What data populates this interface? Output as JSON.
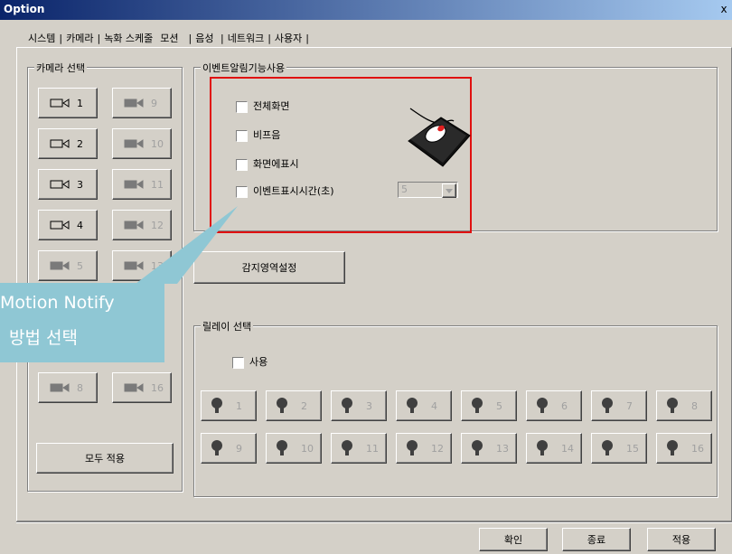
{
  "window": {
    "title": "Option",
    "close_label": "x"
  },
  "tabs": [
    {
      "label": "시스템"
    },
    {
      "label": "카메라"
    },
    {
      "label": "녹화 스케줄"
    },
    {
      "label": "모션"
    },
    {
      "label": "음성"
    },
    {
      "label": "네트워크"
    },
    {
      "label": "사용자"
    }
  ],
  "camera_group": {
    "label": "카메라 선택",
    "cameras": [
      {
        "num": "1",
        "enabled": true
      },
      {
        "num": "9",
        "enabled": false
      },
      {
        "num": "2",
        "enabled": true
      },
      {
        "num": "10",
        "enabled": false
      },
      {
        "num": "3",
        "enabled": true
      },
      {
        "num": "11",
        "enabled": false
      },
      {
        "num": "4",
        "enabled": true
      },
      {
        "num": "12",
        "enabled": false
      },
      {
        "num": "5",
        "enabled": false
      },
      {
        "num": "13",
        "enabled": false
      },
      {
        "num": "8",
        "enabled": false
      },
      {
        "num": "16",
        "enabled": false
      }
    ],
    "apply_all": "모두 적용"
  },
  "event_group": {
    "label": "이벤트알림기능사용",
    "options": [
      "전체화면",
      "비프음",
      "화면에표시",
      "이벤트표시시간(초)"
    ],
    "duration_value": "5"
  },
  "detect_area_button": "감지영역설정",
  "relay_group": {
    "label": "릴레이 선택",
    "use_label": "사용",
    "relays": [
      "1",
      "2",
      "3",
      "4",
      "5",
      "6",
      "7",
      "8",
      "9",
      "10",
      "11",
      "12",
      "13",
      "14",
      "15",
      "16"
    ]
  },
  "callout": {
    "line1": "Motion Notify",
    "line2": "방법 선택",
    "color": "#8fc7d4"
  },
  "footer": {
    "ok": "확인",
    "close": "종료",
    "apply": "적용"
  }
}
